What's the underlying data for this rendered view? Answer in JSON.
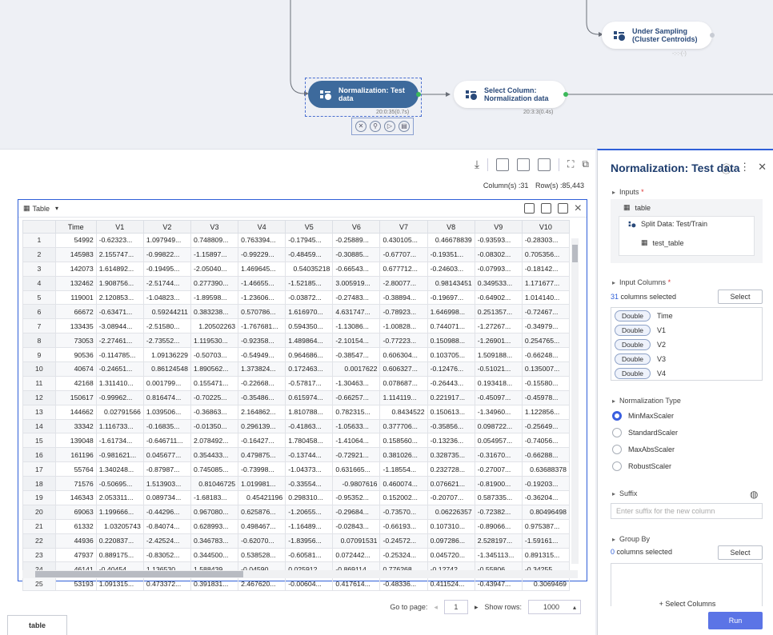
{
  "canvas": {
    "nodes": {
      "under_sampling": {
        "line1": "Under Sampling",
        "line2": "(Cluster Centroids)",
        "time": "-:-:-(-)"
      },
      "normalization": {
        "line1": "Normalization: Test",
        "line2": "data",
        "time": "20:0:35(0.7s)"
      },
      "select_column": {
        "line1": "Select Column:",
        "line2": "Normalization data",
        "time": "20:3:3(0.4s)"
      }
    }
  },
  "toolbar": {
    "columns_label": "Column(s) :31",
    "rows_label": "Row(s) :85,443"
  },
  "table_view": {
    "view_label": "Table",
    "headers": [
      "",
      "Time",
      "V1",
      "V2",
      "V3",
      "V4",
      "V5",
      "V6",
      "V7",
      "V8",
      "V9",
      "V10"
    ],
    "rows": [
      [
        "1",
        "54992",
        "-0.62323...",
        "1.097949...",
        "0.748809...",
        "0.763394...",
        "-0.17945...",
        "-0.25889...",
        "0.430105...",
        "0.46678839",
        "-0.93593...",
        "-0.28303..."
      ],
      [
        "2",
        "145983",
        "2.155747...",
        "-0.99822...",
        "-1.15897...",
        "-0.99229...",
        "-0.48459...",
        "-0.30885...",
        "-0.67707...",
        "-0.19351...",
        "-0.08302...",
        "0.705356..."
      ],
      [
        "3",
        "142073",
        "1.614892...",
        "-0.19495...",
        "-2.05040...",
        "1.469645...",
        "0.54035218",
        "-0.66543...",
        "0.677712...",
        "-0.24603...",
        "-0.07993...",
        "-0.18142..."
      ],
      [
        "4",
        "132462",
        "1.908756...",
        "-2.51744...",
        "0.277390...",
        "-1.46655...",
        "-1.52185...",
        "3.005919...",
        "-2.80077...",
        "0.98143451",
        "0.349533...",
        "1.171677..."
      ],
      [
        "5",
        "119001",
        "2.120853...",
        "-1.04823...",
        "-1.89598...",
        "-1.23606...",
        "-0.03872...",
        "-0.27483...",
        "-0.38894...",
        "-0.19697...",
        "-0.64902...",
        "1.014140..."
      ],
      [
        "6",
        "66672",
        "-0.63471...",
        "0.59244211",
        "0.383238...",
        "0.570786...",
        "1.616970...",
        "4.631747...",
        "-0.78923...",
        "1.646998...",
        "0.251357...",
        "-0.72467..."
      ],
      [
        "7",
        "133435",
        "-3.08944...",
        "-2.51580...",
        "1.20502263",
        "-1.767681...",
        "0.594350...",
        "-1.13086...",
        "-1.00828...",
        "0.744071...",
        "-1.27267...",
        "-0.34979..."
      ],
      [
        "8",
        "73053",
        "-2.27461...",
        "-2.73552...",
        "1.119530...",
        "-0.92358...",
        "1.489864...",
        "-2.10154...",
        "-0.77223...",
        "0.150988...",
        "-1.26901...",
        "0.254765..."
      ],
      [
        "9",
        "90536",
        "-0.114785...",
        "1.09136229",
        "-0.50703...",
        "-0.54949...",
        "0.964686...",
        "-0.38547...",
        "0.606304...",
        "0.103705...",
        "1.509188...",
        "-0.66248..."
      ],
      [
        "10",
        "40674",
        "-0.24651...",
        "0.86124548",
        "1.890562...",
        "1.373824...",
        "0.172463...",
        "0.0017622",
        "0.606327...",
        "-0.12476...",
        "-0.51021...",
        "0.135007..."
      ],
      [
        "11",
        "42168",
        "1.311410...",
        "0.001799...",
        "0.155471...",
        "-0.22668...",
        "-0.57817...",
        "-1.30463...",
        "0.078687...",
        "-0.26443...",
        "0.193418...",
        "-0.15580..."
      ],
      [
        "12",
        "150617",
        "-0.99962...",
        "0.816474...",
        "-0.70225...",
        "-0.35486...",
        "0.615974...",
        "-0.66257...",
        "1.114119...",
        "0.221917...",
        "-0.45097...",
        "-0.45978..."
      ],
      [
        "13",
        "144662",
        "0.02791566",
        "1.039506...",
        "-0.36863...",
        "2.164862...",
        "1.810788...",
        "0.782315...",
        "0.8434522",
        "0.150613...",
        "-1.34960...",
        "1.122856..."
      ],
      [
        "14",
        "33342",
        "1.116733...",
        "-0.16835...",
        "-0.01350...",
        "0.296139...",
        "-0.41863...",
        "-1.05633...",
        "0.377706...",
        "-0.35856...",
        "0.098722...",
        "-0.25649..."
      ],
      [
        "15",
        "139048",
        "-1.61734...",
        "-0.646711...",
        "2.078492...",
        "-0.16427...",
        "1.780458...",
        "-1.41064...",
        "0.158560...",
        "-0.13236...",
        "0.054957...",
        "-0.74056..."
      ],
      [
        "16",
        "161196",
        "-0.981621...",
        "0.045677...",
        "0.354433...",
        "0.479875...",
        "-0.13744...",
        "-0.72921...",
        "0.381026...",
        "0.328735...",
        "-0.31670...",
        "-0.66288..."
      ],
      [
        "17",
        "55764",
        "1.340248...",
        "-0.87987...",
        "0.745085...",
        "-0.73998...",
        "-1.04373...",
        "0.631665...",
        "-1.18554...",
        "0.232728...",
        "-0.27007...",
        "0.63688378"
      ],
      [
        "18",
        "71576",
        "-0.50695...",
        "1.513903...",
        "0.81046725",
        "1.019981...",
        "-0.33554...",
        "-0.9807616",
        "0.460074...",
        "0.076621...",
        "-0.81900...",
        "-0.19203..."
      ],
      [
        "19",
        "146343",
        "2.053311...",
        "0.089734...",
        "-1.68183...",
        "0.45421196",
        "0.298310...",
        "-0.95352...",
        "0.152002...",
        "-0.20707...",
        "0.587335...",
        "-0.36204..."
      ],
      [
        "20",
        "69063",
        "1.199666...",
        "-0.44296...",
        "0.967080...",
        "0.625876...",
        "-1.20655...",
        "-0.29684...",
        "-0.73570...",
        "0.06226357",
        "-0.72382...",
        "0.80496498"
      ],
      [
        "21",
        "61332",
        "1.03205743",
        "-0.84074...",
        "0.628993...",
        "0.498467...",
        "-1.16489...",
        "-0.02843...",
        "-0.66193...",
        "0.107310...",
        "-0.89066...",
        "0.975387..."
      ],
      [
        "22",
        "44936",
        "0.220837...",
        "-2.42524...",
        "0.346783...",
        "-0.62070...",
        "-1.83956...",
        "0.07091531",
        "-0.24572...",
        "0.097286...",
        "2.528197...",
        "-1.59161..."
      ],
      [
        "23",
        "47937",
        "0.889175...",
        "-0.83052...",
        "0.344500...",
        "0.538528...",
        "-0.60581...",
        "0.072442...",
        "-0.25324...",
        "0.045720...",
        "-1.345113...",
        "0.891315..."
      ],
      [
        "24",
        "46141",
        "-0.40454...",
        "1.136530...",
        "1.588439...",
        "-0.04590...",
        "0.025912...",
        "-0.869114...",
        "0.776268...",
        "-0.12742...",
        "-0.55806...",
        "-0.34255..."
      ],
      [
        "25",
        "53193",
        "1.091315...",
        "0.473372...",
        "0.391831...",
        "2.467620...",
        "-0.00604...",
        "0.417614...",
        "-0.48336...",
        "0.411524...",
        "-0.43947...",
        "0.3069469"
      ]
    ]
  },
  "pager": {
    "goto_label": "Go to page:",
    "page": "1",
    "show_rows_label": "Show rows:",
    "rows_value": "1000"
  },
  "bottom_tab": {
    "label": "table"
  },
  "panel": {
    "title": "Normalization: Test data",
    "inputs": {
      "heading": "Inputs",
      "req": "*",
      "items": [
        "table",
        "Split Data: Test/Train",
        "test_table"
      ]
    },
    "input_columns": {
      "heading": "Input Columns",
      "req": "*",
      "count": "31",
      "count_suffix": "columns selected",
      "select_label": "Select",
      "items": [
        {
          "type": "Double",
          "name": "Time"
        },
        {
          "type": "Double",
          "name": "V1"
        },
        {
          "type": "Double",
          "name": "V2"
        },
        {
          "type": "Double",
          "name": "V3"
        },
        {
          "type": "Double",
          "name": "V4"
        }
      ]
    },
    "normalization_type": {
      "heading": "Normalization Type",
      "options": [
        "MinMaxScaler",
        "StandardScaler",
        "MaxAbsScaler",
        "RobustScaler"
      ],
      "selected": "MinMaxScaler"
    },
    "suffix": {
      "heading": "Suffix",
      "placeholder": "Enter suffix for the new column"
    },
    "group_by": {
      "heading": "Group By",
      "count": "0",
      "count_suffix": "columns selected",
      "select_label": "Select",
      "add_label": "+ Select Columns"
    },
    "run_label": "Run"
  },
  "colors": {
    "accent": "#2f5fd8",
    "node_selected": "#3d6a9c",
    "port_ok": "#3cb95a",
    "run_button": "#5b74e6"
  }
}
